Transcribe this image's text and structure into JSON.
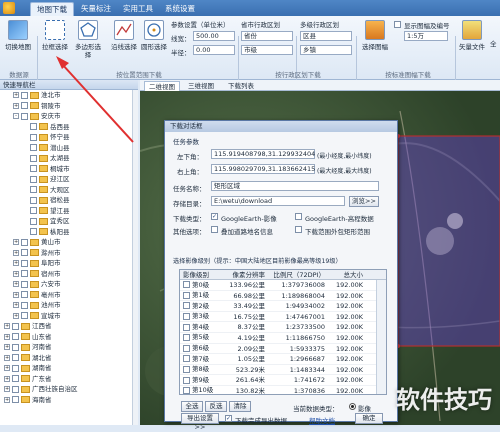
{
  "tabs": [
    "地图下载",
    "矢量标注",
    "实用工具",
    "系统设置"
  ],
  "ribbon": {
    "buttons": [
      {
        "label": "切换地图"
      },
      {
        "label": "拉框选择"
      },
      {
        "label": "多边形选择"
      },
      {
        "label": "沿线选择"
      },
      {
        "label": "圆形选择"
      }
    ],
    "param": {
      "title": "参数设置（单位米）",
      "len_label": "线宽：",
      "len_value": "500.00",
      "radius_label": "半径：",
      "radius_value": "0.00"
    },
    "admin": {
      "title": "省市行政区划",
      "province": "省份",
      "city": "市级"
    },
    "multi": {
      "title": "多级行政区划",
      "district": "区县",
      "town": "乡镇"
    },
    "select_btn": "选择图幅",
    "grid_num": "显示图幅及编号",
    "scale": "1:5万",
    "vector_label": "矢量文件",
    "alllabel": "全",
    "groups": [
      "数据源",
      "按位置范围下载",
      "按行政区划下载",
      "按标准图幅下载"
    ]
  },
  "nav": {
    "title": "快速导航栏",
    "items": [
      {
        "t": "淮北市",
        "d": 3,
        "e": "+"
      },
      {
        "t": "铜陵市",
        "d": 3,
        "e": "+"
      },
      {
        "t": "安庆市",
        "d": 3,
        "e": "-"
      },
      {
        "t": "岳西县",
        "d": 4
      },
      {
        "t": "怀宁县",
        "d": 4
      },
      {
        "t": "潜山县",
        "d": 4
      },
      {
        "t": "太湖县",
        "d": 4
      },
      {
        "t": "桐城市",
        "d": 4
      },
      {
        "t": "迎江区",
        "d": 4
      },
      {
        "t": "大观区",
        "d": 4
      },
      {
        "t": "宿松县",
        "d": 4
      },
      {
        "t": "望江县",
        "d": 4
      },
      {
        "t": "宜秀区",
        "d": 4
      },
      {
        "t": "枞阳县",
        "d": 4
      },
      {
        "t": "黄山市",
        "d": 3,
        "e": "+"
      },
      {
        "t": "滁州市",
        "d": 3,
        "e": "+"
      },
      {
        "t": "阜阳市",
        "d": 3,
        "e": "+"
      },
      {
        "t": "宿州市",
        "d": 3,
        "e": "+"
      },
      {
        "t": "六安市",
        "d": 3,
        "e": "+"
      },
      {
        "t": "亳州市",
        "d": 3,
        "e": "+"
      },
      {
        "t": "池州市",
        "d": 3,
        "e": "+"
      },
      {
        "t": "宣城市",
        "d": 3,
        "e": "+"
      },
      {
        "t": "江西省",
        "d": 2,
        "e": "+"
      },
      {
        "t": "山东省",
        "d": 2,
        "e": "+"
      },
      {
        "t": "河南省",
        "d": 2,
        "e": "+"
      },
      {
        "t": "湖北省",
        "d": 2,
        "e": "+"
      },
      {
        "t": "湖南省",
        "d": 2,
        "e": "+"
      },
      {
        "t": "广东省",
        "d": 2,
        "e": "+"
      },
      {
        "t": "广西壮族自治区",
        "d": 2,
        "e": "+"
      },
      {
        "t": "海南省",
        "d": 2,
        "e": "+"
      }
    ]
  },
  "map": {
    "tabs": [
      "二维视图",
      "三维视图",
      "下载列表"
    ]
  },
  "dialog": {
    "title": "下载对话框",
    "section": "任务参数",
    "lt_label": "左下角：",
    "lt_value": "115.919408798,31.129932404",
    "lt_hint": "(最小经度,最小纬度)",
    "rt_label": "右上角：",
    "rt_value": "115.998029709,31.183662415",
    "rt_hint": "(最大经度,最大纬度)",
    "name_label": "任务名称：",
    "name_value": "矩形区域",
    "dir_label": "存储目录：",
    "dir_value": "E:\\wetu\\download",
    "browse": "浏览>>",
    "type_label": "下载类型：",
    "type_opt1": "GoogleEarth-影像",
    "type_opt2": "GoogleEarth-高程数据",
    "other_label": "其他选项：",
    "other_opt1": "叠加道路地名信息",
    "other_opt2": "下载范围外包矩形范围",
    "level_title": "选择影像级别（提示：中国大陆地区目前影像最高等级19级）",
    "cols": [
      "影像级别",
      "像素分辨率",
      "比例尺（72DPI）",
      "总大小"
    ],
    "rows": [
      {
        "l": "第0级",
        "r": "133.96公里",
        "s": "1:379736008",
        "z": "192.00K"
      },
      {
        "l": "第1级",
        "r": "66.98公里",
        "s": "1:189868004",
        "z": "192.00K"
      },
      {
        "l": "第2级",
        "r": "33.49公里",
        "s": "1:94934002",
        "z": "192.00K"
      },
      {
        "l": "第3级",
        "r": "16.75公里",
        "s": "1:47467001",
        "z": "192.00K"
      },
      {
        "l": "第4级",
        "r": "8.37公里",
        "s": "1:23733500",
        "z": "192.00K"
      },
      {
        "l": "第5级",
        "r": "4.19公里",
        "s": "1:11866750",
        "z": "192.00K"
      },
      {
        "l": "第6级",
        "r": "2.09公里",
        "s": "1:5933375",
        "z": "192.00K"
      },
      {
        "l": "第7级",
        "r": "1.05公里",
        "s": "1:2966687",
        "z": "192.00K"
      },
      {
        "l": "第8级",
        "r": "523.29米",
        "s": "1:1483344",
        "z": "192.00K"
      },
      {
        "l": "第9级",
        "r": "261.64米",
        "s": "1:741672",
        "z": "192.00K"
      },
      {
        "l": "第10级",
        "r": "130.82米",
        "s": "1:370836",
        "z": "192.00K"
      }
    ],
    "select_all": "全选",
    "invert": "反选",
    "clear": "清除",
    "current_type": "当前数据类型：",
    "img_opt": "影像",
    "export": "导出设置>>",
    "done_export": "下载完成导出数据",
    "help": "帮助文档",
    "ok": "确定"
  },
  "watermark": "软件技巧",
  "colors": {
    "accent": "#3a6fb0",
    "selection": "#6a3fd6"
  }
}
